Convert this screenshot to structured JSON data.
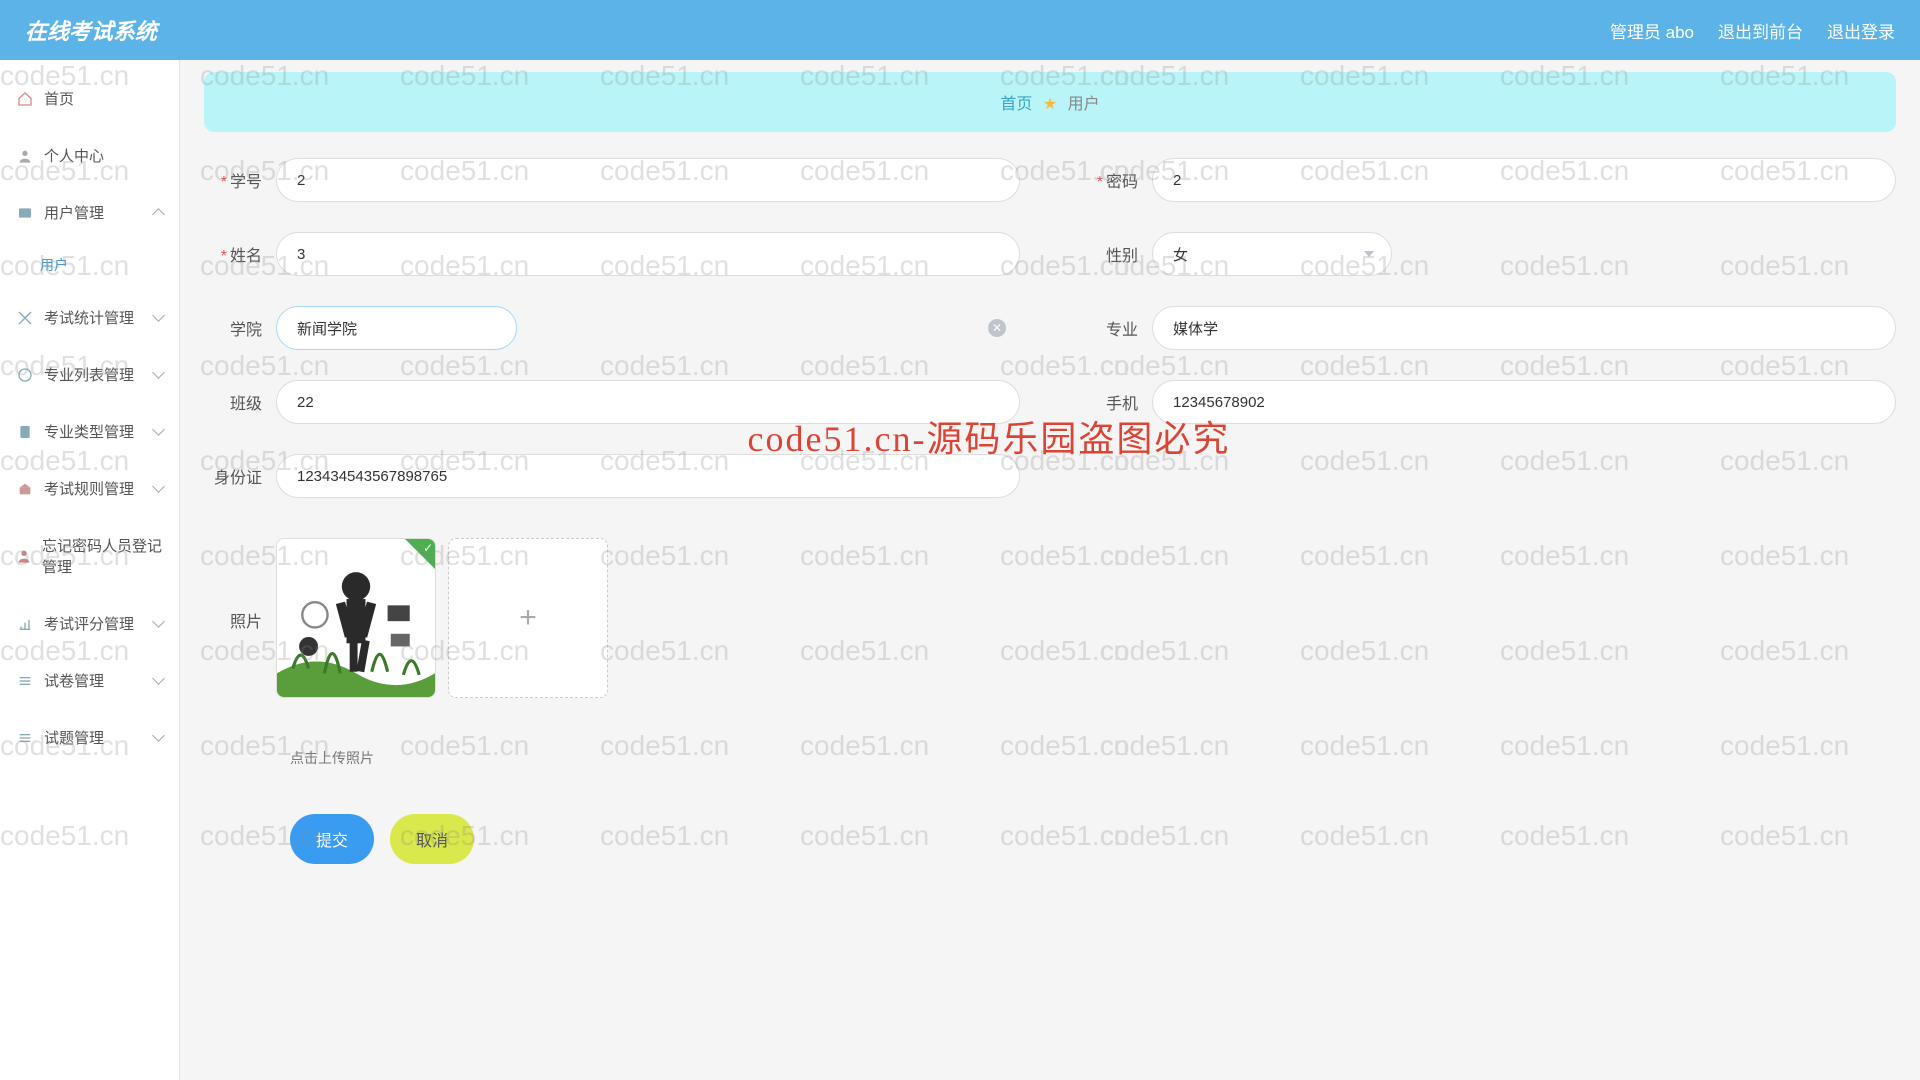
{
  "header": {
    "app_title": "在线考试系统",
    "admin_label": "管理员 abo",
    "back_label": "退出到前台",
    "logout_label": "退出登录"
  },
  "sidebar": {
    "items": [
      {
        "label": "首页"
      },
      {
        "label": "个人中心"
      },
      {
        "label": "用户管理"
      },
      {
        "label": "用户"
      },
      {
        "label": "考试统计管理"
      },
      {
        "label": "专业列表管理"
      },
      {
        "label": "专业类型管理"
      },
      {
        "label": "考试规则管理"
      },
      {
        "label": "忘记密码人员登记管理"
      },
      {
        "label": "考试评分管理"
      },
      {
        "label": "试卷管理"
      },
      {
        "label": "试题管理"
      }
    ]
  },
  "breadcrumb": {
    "home": "首页",
    "current": "用户"
  },
  "form": {
    "student_id": {
      "label": "学号",
      "value": "2"
    },
    "password": {
      "label": "密码",
      "value": "2"
    },
    "name": {
      "label": "姓名",
      "value": "3"
    },
    "gender": {
      "label": "性别",
      "value": "女"
    },
    "college": {
      "label": "学院",
      "value": "新闻学院"
    },
    "major": {
      "label": "专业",
      "value": "媒体学"
    },
    "class": {
      "label": "班级",
      "value": "22"
    },
    "phone": {
      "label": "手机",
      "value": "12345678902"
    },
    "id_card": {
      "label": "身份证",
      "value": "123434543567898765"
    },
    "photo": {
      "label": "照片"
    },
    "upload_hint": "点击上传照片"
  },
  "buttons": {
    "submit": "提交",
    "cancel": "取消"
  },
  "watermark": {
    "text": "code51.cn",
    "center": "code51.cn-源码乐园盗图必究"
  }
}
